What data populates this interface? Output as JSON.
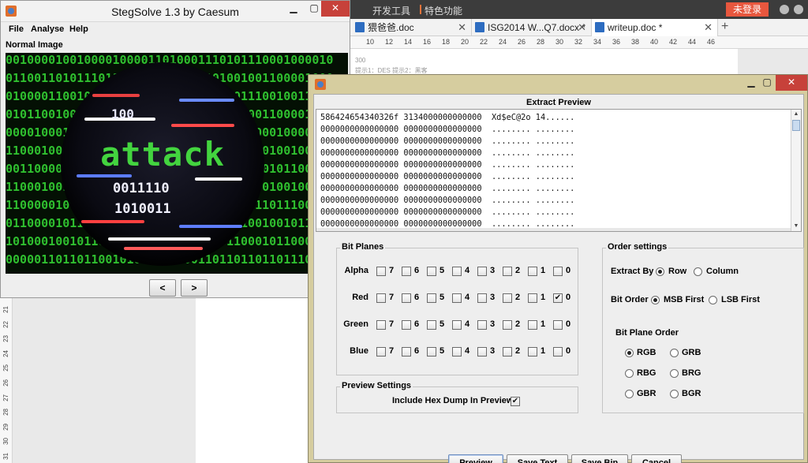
{
  "word_app": {
    "topbar": {
      "dev_tools": "开发工具",
      "features": "特色功能",
      "login": "未登录"
    },
    "tabs": [
      {
        "label": "猥爸爸.doc"
      },
      {
        "label": "ISG2014 W...Q7.docx *"
      },
      {
        "label": "writeup.doc *"
      }
    ],
    "ruler_numbers": [
      "10",
      "12",
      "14",
      "16",
      "18",
      "20",
      "22",
      "24",
      "26",
      "28",
      "30",
      "32",
      "34",
      "36",
      "38",
      "40",
      "42",
      "44",
      "46"
    ],
    "left_ruler_numbers": [
      "21",
      "22",
      "23",
      "24",
      "25",
      "26",
      "27",
      "28",
      "29",
      "30",
      "31"
    ],
    "page_lines": [
      "300",
      "提示1：DES 提示2：黑客"
    ]
  },
  "stegsolve": {
    "title": "StegSolve 1.3 by Caesum",
    "menu": [
      "File",
      "Analyse",
      "Help"
    ],
    "image_label": "Normal Image",
    "image_word": "attack",
    "image_bits_top": "100",
    "image_bits_mid": "0011110",
    "image_bits_low": "1010011",
    "binary_rows": [
      "0010000100100001000011010001110101110001000010",
      "0110011010111011000100011111101001001100001000",
      "0100001100100010110100011001110101110010011101",
      "0101100100001010101101010101011010001100001011",
      "0000100010100010011111001010110001100010000110",
      "1100010010111101010010010101110101110100100100",
      "0011000010100010010000111100101001010101100100",
      "1100010010111101010010010101110101100100100100",
      "1100000100001100011100110010101001011011100100",
      "0110000101100011100100100100100111001001011000",
      "1010001001011001000111011010000110001011000100",
      "0000011011011001010011011001101101101101110100"
    ],
    "nav": {
      "prev": "<",
      "next": ">"
    }
  },
  "extract_preview": {
    "heading": "Extract Preview",
    "hex_rows": [
      "586424654340326f 3134000000000000  Xd$eC@2o 14......",
      "0000000000000000 0000000000000000  ........ ........",
      "0000000000000000 0000000000000000  ........ ........",
      "0000000000000000 0000000000000000  ........ ........",
      "0000000000000000 0000000000000000  ........ ........",
      "0000000000000000 0000000000000000  ........ ........",
      "0000000000000000 0000000000000000  ........ ........",
      "0000000000000000 0000000000000000  ........ ........",
      "0000000000000000 0000000000000000  ........ ........",
      "0000000000000000 0000000000000000  ........ ........",
      "0000000000000000 0000000000000000  ........ ........"
    ],
    "bit_planes": {
      "title": "Bit Planes",
      "bits": [
        "7",
        "6",
        "5",
        "4",
        "3",
        "2",
        "1",
        "0"
      ],
      "rows": [
        {
          "label": "Alpha",
          "checked": []
        },
        {
          "label": "Red",
          "checked": [
            "0"
          ]
        },
        {
          "label": "Green",
          "checked": []
        },
        {
          "label": "Blue",
          "checked": []
        }
      ]
    },
    "preview_settings": {
      "title": "Preview Settings",
      "hex_dump_label": "Include Hex Dump In Preview",
      "hex_dump_checked": true
    },
    "order_settings": {
      "title": "Order settings",
      "extract_by_label": "Extract By",
      "extract_by_options": [
        "Row",
        "Column"
      ],
      "extract_by_selected": "Row",
      "bit_order_label": "Bit Order",
      "bit_order_options": [
        "MSB First",
        "LSB First"
      ],
      "bit_order_selected": "MSB First",
      "plane_order_label": "Bit Plane Order",
      "plane_order_options": [
        "RGB",
        "GRB",
        "RBG",
        "BRG",
        "GBR",
        "BGR"
      ],
      "plane_order_selected": "RGB"
    },
    "buttons": {
      "preview": "Preview",
      "save_text": "Save Text",
      "save_bin": "Save Bin",
      "cancel": "Cancel"
    },
    "check_mark": "✔"
  }
}
